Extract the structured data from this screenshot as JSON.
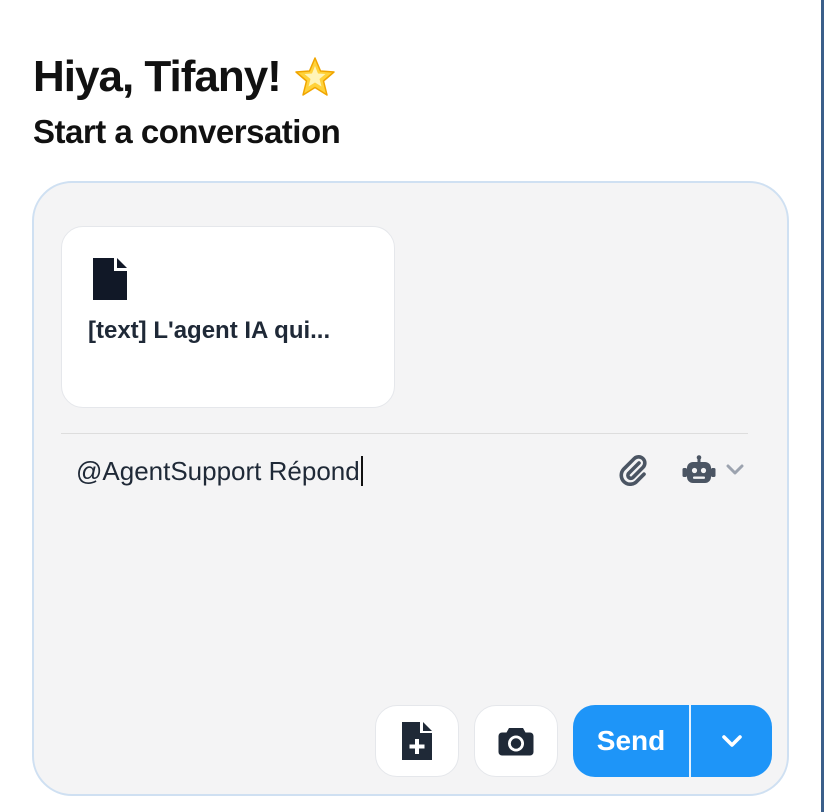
{
  "greeting": {
    "title": "Hiya, Tifany!",
    "emoji_icon": "glowing-star-icon"
  },
  "subtitle": "Start a conversation",
  "attachment": {
    "icon": "document-icon",
    "name": "[text] L'agent IA qui..."
  },
  "input": {
    "value": "@AgentSupport Répond"
  },
  "toolbar": {
    "attach_icon": "paperclip-icon",
    "agent_icon": "robot-icon",
    "add_file_icon": "file-plus-icon",
    "camera_icon": "camera-icon"
  },
  "send": {
    "label": "Send",
    "options_icon": "chevron-down-icon"
  },
  "colors": {
    "accent": "#1e95f8",
    "composer_bg": "#f4f4f5",
    "border": "#cfe0f2"
  }
}
